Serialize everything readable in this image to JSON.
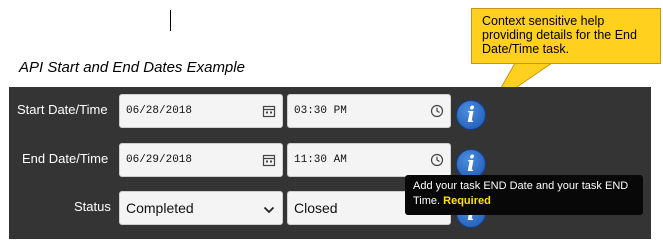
{
  "page": {
    "title": "API Start and End Dates Example"
  },
  "callout": {
    "text": "Context sensitive help providing details for the End Date/Time task."
  },
  "form": {
    "start": {
      "label": "Start Date/Time",
      "date_value": "06/28/2018",
      "time_value": "03:30 PM"
    },
    "end": {
      "label": "End Date/Time",
      "date_value": "06/29/2018",
      "time_value": "11:30 AM"
    },
    "status": {
      "label": "Status",
      "value": "Completed",
      "secondary_value": "Closed"
    },
    "info_icon_glyph": "i"
  },
  "tooltip": {
    "text": "Add your task END Date and your task END Time.",
    "required": "Required"
  },
  "colors": {
    "panel": "#343434",
    "callout": "#ffd01e",
    "info_button": "#2a6bc6",
    "required": "#ffe000"
  },
  "icons": {
    "calendar": "calendar-icon",
    "clock": "clock-icon",
    "dropdown": "chevron-down-icon",
    "help": "info-icon"
  }
}
